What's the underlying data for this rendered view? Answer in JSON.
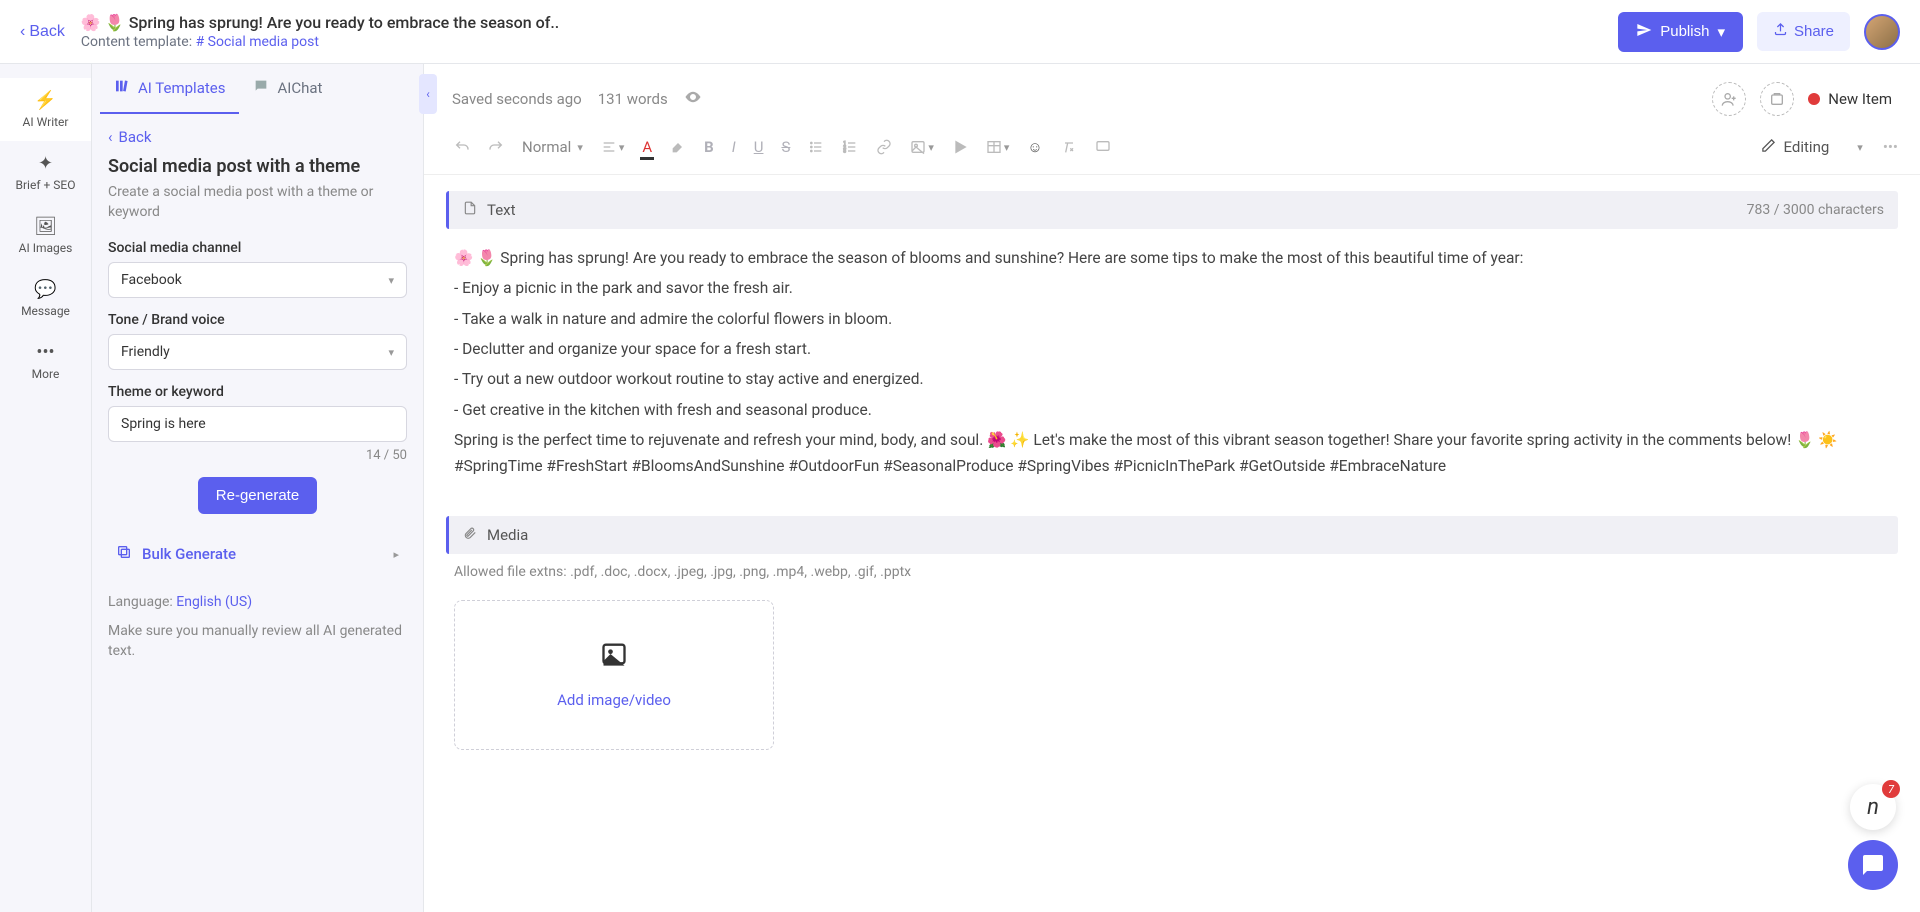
{
  "header": {
    "back": "Back",
    "title": "🌸 🌷 Spring has sprung! Are you ready to embrace the season of..",
    "templateLabel": "Content template:",
    "templateName": "# Social media post",
    "publish": "Publish",
    "share": "Share"
  },
  "rail": {
    "aiWriter": "AI Writer",
    "briefSeo": "Brief + SEO",
    "aiImages": "AI Images",
    "message": "Message",
    "more": "More"
  },
  "sidebar": {
    "tabTemplates": "AI Templates",
    "tabChat": "AIChat",
    "back": "Back",
    "heading": "Social media post with a theme",
    "sub": "Create a social media post with a theme or keyword",
    "channelLabel": "Social media channel",
    "channelValue": "Facebook",
    "toneLabel": "Tone / Brand voice",
    "toneValue": "Friendly",
    "themeLabel": "Theme or keyword",
    "themeValue": "Spring is here",
    "themeCount": "14 / 50",
    "regenerate": "Re-generate",
    "bulk": "Bulk Generate",
    "languageLabel": "Language:",
    "languageValue": "English (US)",
    "reviewNote": "Make sure you manually review all AI generated text."
  },
  "editor": {
    "saved": "Saved seconds ago",
    "wordCount": "131 words",
    "newItem": "New Item",
    "normal": "Normal",
    "editing": "Editing",
    "textSection": "Text",
    "charCount": "783 / 3000 characters",
    "mediaSection": "Media",
    "mediaNote": "Allowed file extns: .pdf, .doc, .docx, .jpeg, .jpg, .png, .mp4, .webp, .gif, .pptx",
    "uploadLabel": "Add image/video"
  },
  "content": {
    "intro": "🌸 🌷 Spring has sprung! Are you ready to embrace the season of blooms and sunshine? Here are some tips to make the most of this beautiful time of year:",
    "b1": "- Enjoy a picnic in the park and savor the fresh air.",
    "b2": "- Take a walk in nature and admire the colorful flowers in bloom.",
    "b3": "- Declutter and organize your space for a fresh start.",
    "b4": "- Try out a new outdoor workout routine to stay active and energized.",
    "b5": "- Get creative in the kitchen with fresh and seasonal produce.",
    "outro": "Spring is the perfect time to rejuvenate and refresh your mind, body, and soul. 🌺 ✨ Let's make the most of this vibrant season together! Share your favorite spring activity in the comments below! 🌷 ☀️ #SpringTime #FreshStart #BloomsAndSunshine #OutdoorFun #SeasonalProduce #SpringVibes #PicnicInThePark #GetOutside #EmbraceNature"
  },
  "float": {
    "badge": "7"
  }
}
